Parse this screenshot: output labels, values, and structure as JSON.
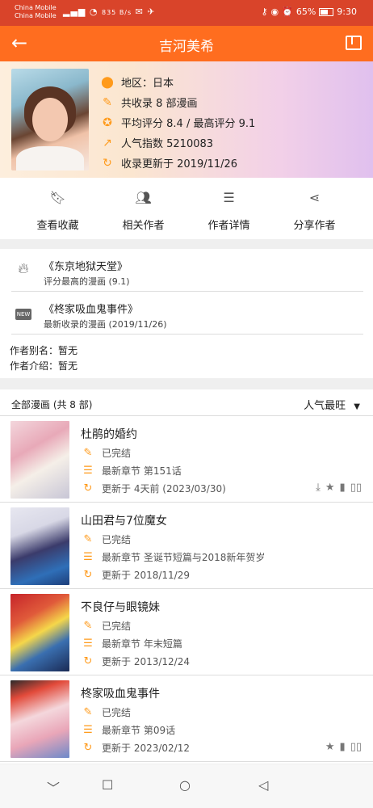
{
  "status_bar": {
    "carrier1": "China Mobile",
    "carrier2": "China Mobile",
    "speed": "835 B/s",
    "battery": "65%",
    "time": "9:30",
    "battery_level": 0.65
  },
  "appbar": {
    "title": "吉河美希",
    "back_icon": "arrow-left-icon",
    "share_icon": "share-out-icon"
  },
  "author": {
    "region": "地区：日本",
    "count": "共收录 8 部漫画",
    "rating": "平均评分 8.4 / 最高评分 9.1",
    "popularity": "人气指数 5210083",
    "updated": "收录更新于 2019/11/26"
  },
  "actions": [
    {
      "label": "查看收藏",
      "icon": "bookmark-icon"
    },
    {
      "label": "相关作者",
      "icon": "people-icon"
    },
    {
      "label": "作者详情",
      "icon": "list-icon"
    },
    {
      "label": "分享作者",
      "icon": "share-icon"
    }
  ],
  "highlights": {
    "top_title": "《东京地狱天堂》",
    "top_sub": "评分最高的漫画 (9.1)",
    "new_badge": "NEW",
    "new_title": "《柊家吸血鬼事件》",
    "new_sub": "最新收录的漫画 (2019/11/26)",
    "alias": "作者别名：暂无",
    "intro": "作者介绍：暂无"
  },
  "list_header": {
    "left": "全部漫画 (共 8 部)",
    "sort": "人气最旺"
  },
  "comics": [
    {
      "title": "杜鹃的婚约",
      "status": "已完结",
      "chapter": "最新章节 第151话",
      "updated": "更新于 4天前 (2023/03/30)"
    },
    {
      "title": "山田君与7位魔女",
      "status": "已完结",
      "chapter": "最新章节 圣诞节短篇与2018新年贺岁",
      "updated": "更新于 2018/11/29"
    },
    {
      "title": "不良仔与眼镜妹",
      "status": "已完结",
      "chapter": "最新章节 年末短篇",
      "updated": "更新于 2013/12/24"
    },
    {
      "title": "柊家吸血鬼事件",
      "status": "已完结",
      "chapter": "最新章节 第09话",
      "updated": "更新于 2023/02/12"
    }
  ],
  "colors": {
    "appbar": "#ff6d1f",
    "statusbar": "#d9442a",
    "accent_icon": "#ff9a1a"
  }
}
